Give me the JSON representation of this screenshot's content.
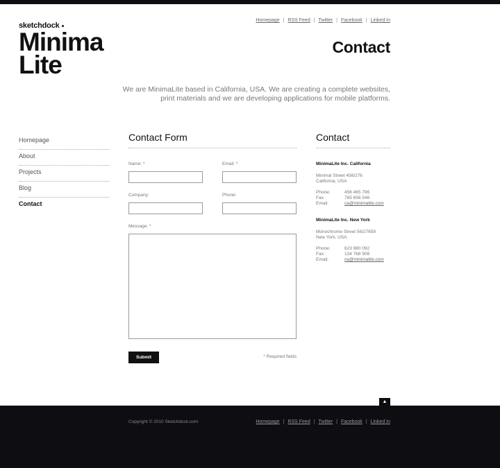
{
  "top_links": [
    "Homepage",
    "RSS Feed",
    "Twitter",
    "Facebook",
    "Linked In"
  ],
  "logo": {
    "small": "sketchdock",
    "line1": "Minima",
    "line2": "Lite"
  },
  "page_title": "Contact",
  "intro_line1": "We are MinimaLite based in California, USA. We are creating a complete websites,",
  "intro_line2": "print materials and we are developing applications for mobile platforms.",
  "nav": [
    "Homepage",
    "About",
    "Projects",
    "Blog",
    "Contact"
  ],
  "nav_active": "Contact",
  "form": {
    "title": "Contact Form",
    "name_label": "Name: *",
    "email_label": "Email: *",
    "company_label": "Company:",
    "phone_label": "Phone:",
    "message_label": "Message: *",
    "submit_label": "Submit",
    "required_note": "* Required fields"
  },
  "contact": {
    "title": "Contact",
    "offices": [
      {
        "name": "MinimaLite Inc. California",
        "address1": "Minimal Street 456/276",
        "address2": "California, USA",
        "phone_label": "Phone:",
        "phone": "456 465 786",
        "fax_label": "Fax:",
        "fax": "765 656 546",
        "email_label": "Email:",
        "email": "ca@minimalite.com"
      },
      {
        "name": "MinimaLite Inc. New York",
        "address1": "Monochrome Street 56/27658",
        "address2": "New York, USA",
        "phone_label": "Phone:",
        "phone": "623 980 092",
        "fax_label": "Fax:",
        "fax": "134 768 908",
        "email_label": "Email:",
        "email": "ny@minimalite.com"
      }
    ]
  },
  "footer": {
    "copyright": "Copyright © 2010  Sketchdock.com",
    "links": [
      "Homepage",
      "RSS Feed",
      "Twitter",
      "Facebook",
      "Linked In"
    ],
    "back_to_top_icon": "arrow-up-icon"
  },
  "colors": {
    "dark": "#0e0d12",
    "text": "#333333",
    "muted": "#777777"
  }
}
